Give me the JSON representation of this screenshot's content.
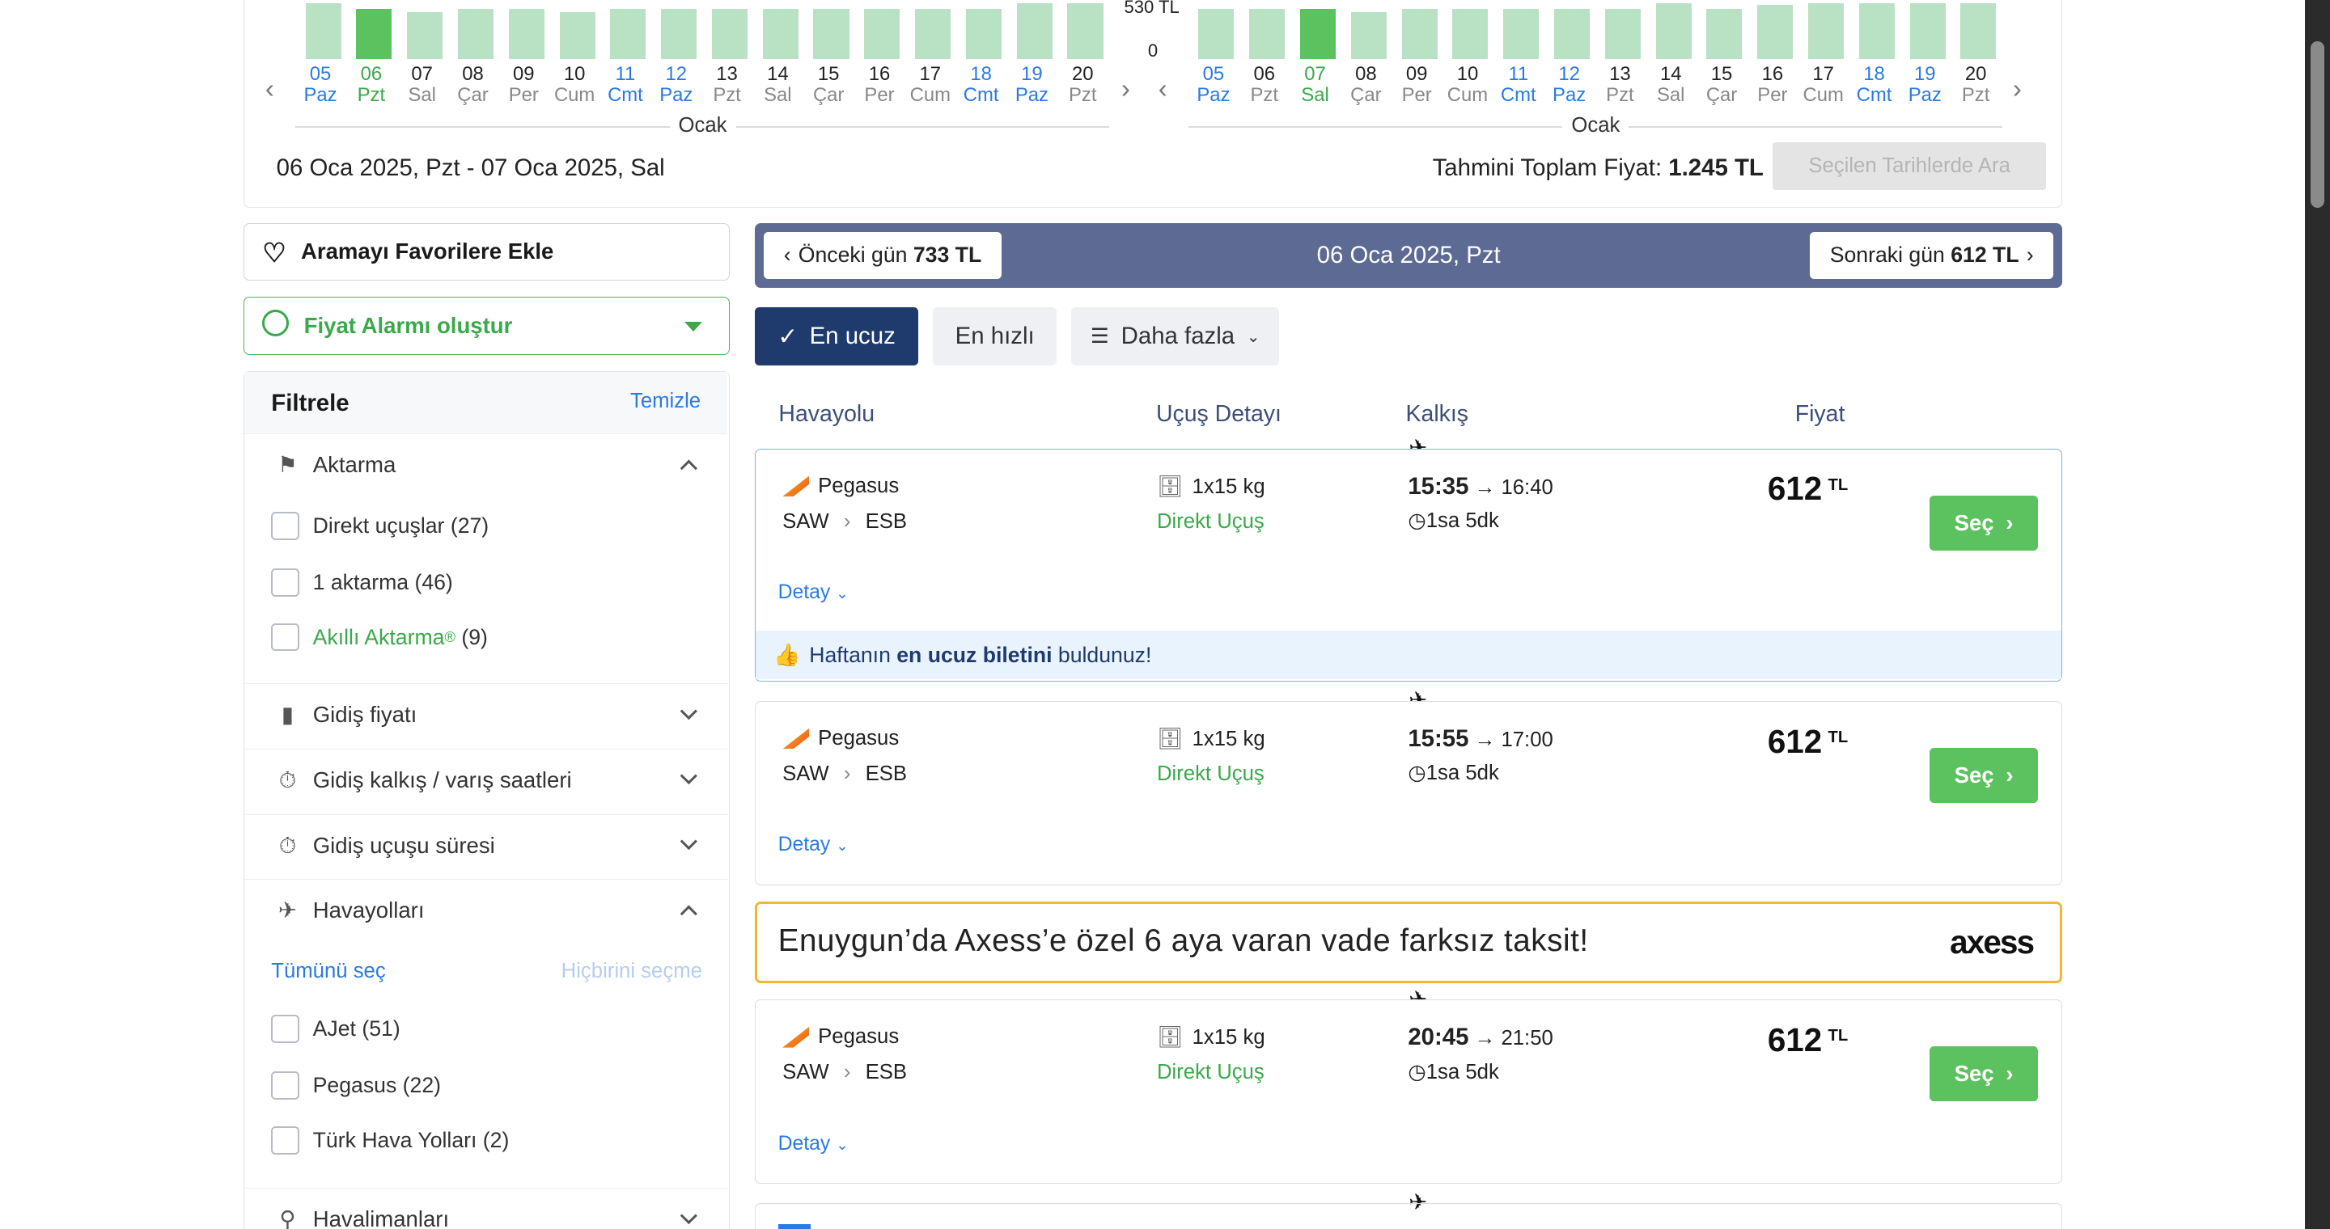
{
  "calendar": {
    "y_max_label": "530 TL",
    "y_zero_label": "0",
    "month_label": "Ocak",
    "left_days": [
      {
        "d": "05",
        "w": "Paz",
        "v": 0.95,
        "c": "blue"
      },
      {
        "d": "06",
        "w": "Pzt",
        "v": 0.85,
        "c": "green",
        "sel": true
      },
      {
        "d": "07",
        "w": "Sal",
        "v": 0.8,
        "c": ""
      },
      {
        "d": "08",
        "w": "Çar",
        "v": 0.85,
        "c": ""
      },
      {
        "d": "09",
        "w": "Per",
        "v": 0.85,
        "c": ""
      },
      {
        "d": "10",
        "w": "Cum",
        "v": 0.8,
        "c": ""
      },
      {
        "d": "11",
        "w": "Cmt",
        "v": 0.85,
        "c": "blue"
      },
      {
        "d": "12",
        "w": "Paz",
        "v": 0.85,
        "c": "blue"
      },
      {
        "d": "13",
        "w": "Pzt",
        "v": 0.85,
        "c": ""
      },
      {
        "d": "14",
        "w": "Sal",
        "v": 0.85,
        "c": ""
      },
      {
        "d": "15",
        "w": "Çar",
        "v": 0.85,
        "c": ""
      },
      {
        "d": "16",
        "w": "Per",
        "v": 0.85,
        "c": ""
      },
      {
        "d": "17",
        "w": "Cum",
        "v": 0.85,
        "c": ""
      },
      {
        "d": "18",
        "w": "Cmt",
        "v": 0.85,
        "c": "blue"
      },
      {
        "d": "19",
        "w": "Paz",
        "v": 0.95,
        "c": "blue"
      },
      {
        "d": "20",
        "w": "Pzt",
        "v": 0.95,
        "c": ""
      }
    ],
    "right_days": [
      {
        "d": "05",
        "w": "Paz",
        "v": 0.85,
        "c": "blue"
      },
      {
        "d": "06",
        "w": "Pzt",
        "v": 0.85,
        "c": ""
      },
      {
        "d": "07",
        "w": "Sal",
        "v": 0.85,
        "c": "green",
        "sel": true
      },
      {
        "d": "08",
        "w": "Çar",
        "v": 0.8,
        "c": ""
      },
      {
        "d": "09",
        "w": "Per",
        "v": 0.85,
        "c": ""
      },
      {
        "d": "10",
        "w": "Cum",
        "v": 0.85,
        "c": ""
      },
      {
        "d": "11",
        "w": "Cmt",
        "v": 0.85,
        "c": "blue"
      },
      {
        "d": "12",
        "w": "Paz",
        "v": 0.85,
        "c": "blue"
      },
      {
        "d": "13",
        "w": "Pzt",
        "v": 0.85,
        "c": ""
      },
      {
        "d": "14",
        "w": "Sal",
        "v": 0.95,
        "c": ""
      },
      {
        "d": "15",
        "w": "Çar",
        "v": 0.85,
        "c": ""
      },
      {
        "d": "16",
        "w": "Per",
        "v": 0.92,
        "c": ""
      },
      {
        "d": "17",
        "w": "Cum",
        "v": 0.95,
        "c": ""
      },
      {
        "d": "18",
        "w": "Cmt",
        "v": 0.95,
        "c": "blue"
      },
      {
        "d": "19",
        "w": "Paz",
        "v": 0.95,
        "c": "blue"
      },
      {
        "d": "20",
        "w": "Pzt",
        "v": 0.95,
        "c": ""
      }
    ],
    "date_range": "06 Oca 2025, Pzt - 07 Oca 2025, Sal",
    "total_label": "Tahmini Toplam Fiyat:",
    "total_value": "1.245 TL",
    "search_button": "Seçilen Tarihlerde Ara"
  },
  "sidebar": {
    "favorite": "Aramayı Favorilere Ekle",
    "alarm": "Fiyat Alarmı oluştur",
    "filter_title": "Filtrele",
    "filter_clear": "Temizle",
    "sections": {
      "stops": "Aktarma",
      "price": "Gidiş fiyatı",
      "times": "Gidiş kalkış / varış saatleri",
      "duration": "Gidiş uçuşu süresi",
      "airlines": "Havayolları",
      "airports": "Havalimanları"
    },
    "stops_options": [
      "Direkt uçuşlar (27)",
      "1 aktarma (46)"
    ],
    "smart_stop": "Akıllı Aktarma",
    "smart_stop_count": "(9)",
    "select_all": "Tümünü seç",
    "select_none": "Hiçbirini seçme",
    "airline_options": [
      "AJet (51)",
      "Pegasus (22)",
      "Türk Hava Yolları (2)"
    ]
  },
  "daynav": {
    "prev_label": "Önceki gün",
    "prev_price": "733 TL",
    "current": "06 Oca 2025, Pzt",
    "next_label": "Sonraki gün",
    "next_price": "612 TL"
  },
  "sort": {
    "cheapest": "En ucuz",
    "fastest": "En hızlı",
    "more": "Daha fazla"
  },
  "columns": {
    "airline": "Havayolu",
    "details": "Uçuş Detayı",
    "departure": "Kalkış",
    "price": "Fiyat"
  },
  "flights": [
    {
      "airline": "Pegasus",
      "from": "SAW",
      "to": "ESB",
      "bag": "1x15 kg",
      "type": "Direkt Uçuş",
      "dep": "15:35",
      "arr": "16:40",
      "dur": "1sa 5dk",
      "price": "612",
      "cur": "TL",
      "select": "Seç",
      "detail": "Detay"
    },
    {
      "airline": "Pegasus",
      "from": "SAW",
      "to": "ESB",
      "bag": "1x15 kg",
      "type": "Direkt Uçuş",
      "dep": "15:55",
      "arr": "17:00",
      "dur": "1sa 5dk",
      "price": "612",
      "cur": "TL",
      "select": "Seç",
      "detail": "Detay"
    },
    {
      "airline": "Pegasus",
      "from": "SAW",
      "to": "ESB",
      "bag": "1x15 kg",
      "type": "Direkt Uçuş",
      "dep": "20:45",
      "arr": "21:50",
      "dur": "1sa 5dk",
      "price": "612",
      "cur": "TL",
      "select": "Seç",
      "detail": "Detay"
    }
  ],
  "cheapest_note": {
    "pre": "Haftanın",
    "bold": "en ucuz biletini",
    "post": "buldunuz!"
  },
  "banner": {
    "text": "Enuygun’da Axess’e özel 6 aya varan vade farksız taksit!",
    "logo": "axess"
  },
  "colors": {
    "green": "#5cc15f",
    "navy": "#1f3b6e",
    "nav_bg": "#5d6b94",
    "blue": "#2a7ae4",
    "yellow": "#f2b833"
  }
}
